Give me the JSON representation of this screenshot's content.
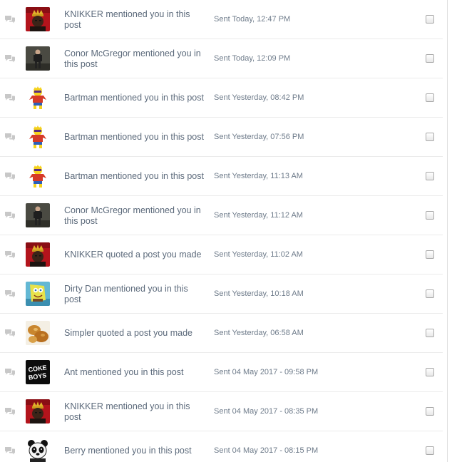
{
  "notifications": [
    {
      "avatar": "biggie-crown-avatar",
      "message": "KNIKKER mentioned you in this post",
      "date": "Sent Today, 12:47 PM"
    },
    {
      "avatar": "standing-man-avatar",
      "message": "Conor McGregor mentioned you in this post",
      "date": "Sent Today, 12:09 PM"
    },
    {
      "avatar": "bartman-avatar",
      "message": "Bartman mentioned you in this post",
      "date": "Sent Yesterday, 08:42 PM"
    },
    {
      "avatar": "bartman-avatar",
      "message": "Bartman mentioned you in this post",
      "date": "Sent Yesterday, 07:56 PM"
    },
    {
      "avatar": "bartman-avatar",
      "message": "Bartman mentioned you in this post",
      "date": "Sent Yesterday, 11:13 AM"
    },
    {
      "avatar": "standing-man-avatar",
      "message": "Conor McGregor mentioned you in this post",
      "date": "Sent Yesterday, 11:12 AM"
    },
    {
      "avatar": "biggie-crown-avatar",
      "message": "KNIKKER quoted a post you made",
      "date": "Sent Yesterday, 11:02 AM"
    },
    {
      "avatar": "spongebob-avatar",
      "message": "Dirty Dan mentioned you in this post",
      "date": "Sent Yesterday, 10:18 AM"
    },
    {
      "avatar": "fried-food-avatar",
      "message": "Simpler quoted a post you made",
      "date": "Sent Yesterday, 06:58 AM"
    },
    {
      "avatar": "coke-boys-avatar",
      "message": "Ant mentioned you in this post",
      "date": "Sent 04 May 2017 - 09:58 PM"
    },
    {
      "avatar": "biggie-crown-avatar",
      "message": "KNIKKER mentioned you in this post",
      "date": "Sent 04 May 2017 - 08:35 PM"
    },
    {
      "avatar": "panda-avatar",
      "message": "Berry mentioned you in this post",
      "date": "Sent 04 May 2017 - 08:15 PM"
    }
  ],
  "avatar_art": {
    "coke_boys_text_line1": "COKE",
    "coke_boys_text_line2": "BOYS"
  },
  "colors": {
    "message_text": "#5c6a7b",
    "date_text": "#6e7b8a",
    "row_divider": "#ebebeb",
    "bubble_icon": "#c8c8c8"
  }
}
